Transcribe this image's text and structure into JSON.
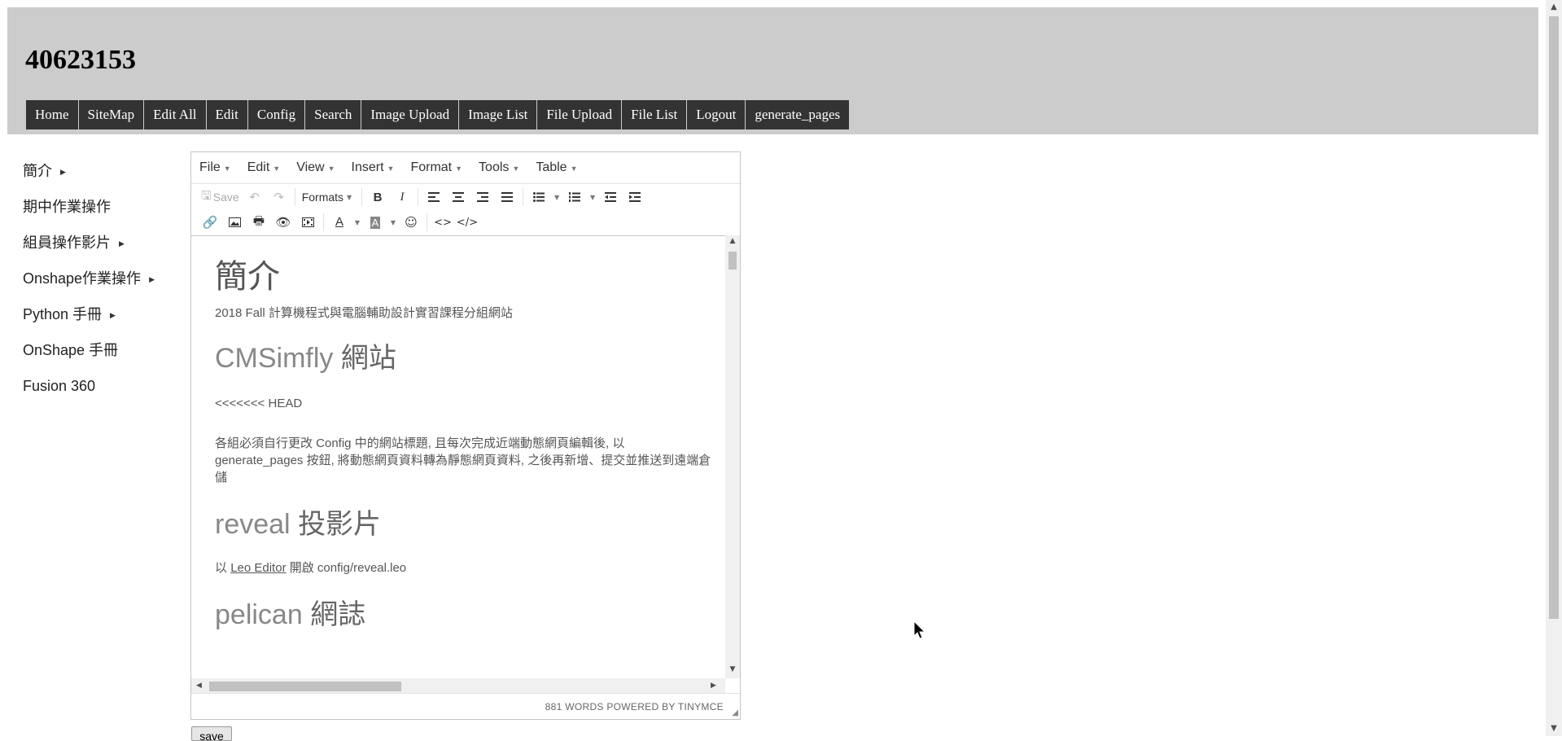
{
  "site": {
    "title": "40623153"
  },
  "nav": [
    "Home",
    "SiteMap",
    "Edit All",
    "Edit",
    "Config",
    "Search",
    "Image Upload",
    "Image List",
    "File Upload",
    "File List",
    "Logout",
    "generate_pages"
  ],
  "menu": [
    {
      "label": "簡介",
      "submenu": true
    },
    {
      "label": "期中作業操作",
      "submenu": false
    },
    {
      "label": "組員操作影片",
      "submenu": true
    },
    {
      "label": "Onshape作業操作",
      "submenu": true
    },
    {
      "label": "Python 手冊",
      "submenu": true
    },
    {
      "label": "OnShape 手冊",
      "submenu": false
    },
    {
      "label": "Fusion 360",
      "submenu": false
    }
  ],
  "editor": {
    "menubar": [
      "File",
      "Edit",
      "View",
      "Insert",
      "Format",
      "Tools",
      "Table"
    ],
    "save_label": "Save",
    "formats_label": "Formats",
    "content": {
      "h1": "簡介",
      "p1": "2018 Fall 計算機程式與電腦輔助設計實習課程分組網站",
      "h2a_latin": "CMSimfly",
      "h2a_cjk": "網站",
      "p2": "<<<<<<< HEAD",
      "p3": "各組必須自行更改 Config 中的網站標題, 且每次完成近端動態網頁編輯後, 以 generate_pages 按鈕, 將動態網頁資料轉為靜態網頁資料, 之後再新增、提交並推送到遠端倉儲",
      "h2b_latin": "reveal",
      "h2b_cjk": "投影片",
      "p4_pre": "以",
      "p4_link": "Leo Editor",
      "p4_post": "開啟 config/reveal.leo",
      "h2c_latin": "pelican",
      "h2c_cjk": "網誌"
    },
    "status": "881 WORDS POWERED BY TINYMCE"
  },
  "save_button": "save"
}
